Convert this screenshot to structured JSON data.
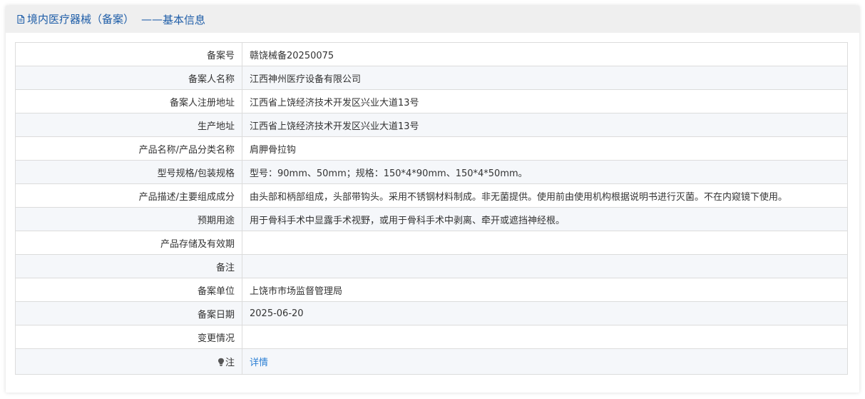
{
  "header": {
    "title": "境内医疗器械（备案）",
    "separator": "——",
    "subtitle": "基本信息",
    "icon": "document-icon"
  },
  "rows": [
    {
      "label": "备案号",
      "value": "赣饶械备20250075"
    },
    {
      "label": "备案人名称",
      "value": "江西神州医疗设备有限公司"
    },
    {
      "label": "备案人注册地址",
      "value": "江西省上饶经济技术开发区兴业大道13号"
    },
    {
      "label": "生产地址",
      "value": "江西省上饶经济技术开发区兴业大道13号"
    },
    {
      "label": "产品名称/产品分类名称",
      "value": "肩胛骨拉钩"
    },
    {
      "label": "型号规格/包装规格",
      "value": "型号：90mm、50mm；规格：150*4*90mm、150*4*50mm。"
    },
    {
      "label": "产品描述/主要组成成分",
      "value": "由头部和柄部组成，头部带钩头。采用不锈钢材料制成。非无菌提供。使用前由使用机构根据说明书进行灭菌。不在内窥镜下使用。"
    },
    {
      "label": "预期用途",
      "value": "用于骨科手术中显露手术视野，或用于骨科手术中剥离、牵开或遮挡神经根。"
    },
    {
      "label": "产品存储及有效期",
      "value": ""
    },
    {
      "label": "备注",
      "value": ""
    },
    {
      "label": "备案单位",
      "value": "上饶市市场监督管理局"
    },
    {
      "label": "备案日期",
      "value": "2025-06-20"
    },
    {
      "label": "变更情况",
      "value": ""
    }
  ],
  "note": {
    "label": "注",
    "icon": "lightbulb-icon",
    "link_text": "详情"
  },
  "colors": {
    "title": "#1f5ea8",
    "link": "#2a7fd4",
    "header_bg": "#efefef",
    "border": "#dcdcdc",
    "stripe": "#f5f7fa"
  }
}
